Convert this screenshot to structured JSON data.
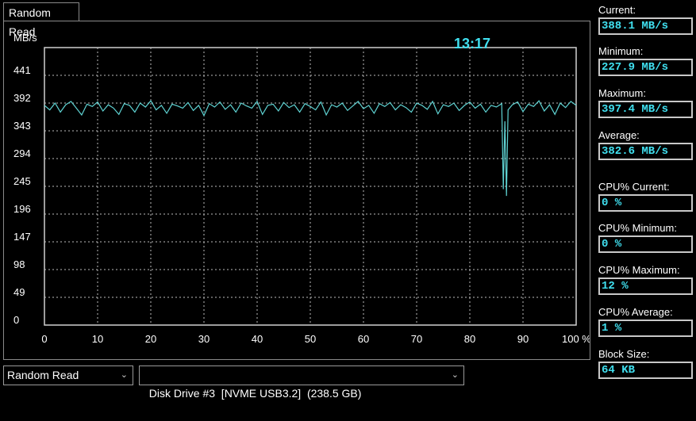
{
  "tab": {
    "label": "Random Read"
  },
  "chart_data": {
    "type": "line",
    "ylabel": "MB/s",
    "y_ticks": [
      "441",
      "392",
      "343",
      "294",
      "245",
      "196",
      "147",
      "98",
      "49",
      "0"
    ],
    "x_ticks": [
      "0",
      "10",
      "20",
      "30",
      "40",
      "50",
      "60",
      "70",
      "80",
      "90",
      "100 %"
    ],
    "ylim": [
      0,
      490
    ],
    "xlim": [
      0,
      100
    ],
    "grid": true,
    "timer": "13:17",
    "line_color": "#5fd3d3",
    "series": [
      {
        "x": [
          0,
          1,
          2,
          3,
          4,
          5,
          6,
          7,
          8,
          9,
          10,
          11,
          12,
          13,
          14,
          15,
          16,
          17,
          18,
          19,
          20,
          21,
          22,
          23,
          24,
          25,
          26,
          27,
          28,
          29,
          30,
          31,
          32,
          33,
          34,
          35,
          36,
          37,
          38,
          39,
          40,
          41,
          42,
          43,
          44,
          45,
          46,
          47,
          48,
          49,
          50,
          51,
          52,
          53,
          54,
          55,
          56,
          57,
          58,
          59,
          60,
          61,
          62,
          63,
          64,
          65,
          66,
          67,
          68,
          69,
          70,
          71,
          72,
          73,
          74,
          75,
          76,
          77,
          78,
          79,
          80,
          81,
          82,
          83,
          84,
          85,
          86,
          86.3,
          86.6,
          86.9,
          87.2,
          88,
          89,
          90,
          91,
          92,
          93,
          94,
          95,
          96,
          97,
          98,
          99,
          100
        ],
        "values": [
          388,
          380,
          392,
          376,
          389,
          395,
          383,
          371,
          390,
          386,
          394,
          378,
          389,
          383,
          372,
          391,
          388,
          376,
          392,
          385,
          396,
          380,
          388,
          374,
          390,
          387,
          383,
          393,
          379,
          388,
          370,
          391,
          385,
          394,
          381,
          389,
          376,
          392,
          387,
          383,
          395,
          372,
          388,
          390,
          378,
          393,
          384,
          389,
          376,
          391,
          386,
          380,
          394,
          371,
          389,
          385,
          392,
          379,
          387,
          395,
          382,
          388,
          374,
          391,
          386,
          393,
          380,
          389,
          384,
          376,
          392,
          388,
          381,
          395,
          373,
          389,
          386,
          392,
          379,
          388,
          394,
          383,
          390,
          376,
          388,
          385,
          391,
          240,
          360,
          228,
          380,
          389,
          394,
          377,
          390,
          386,
          396,
          378,
          389,
          372,
          392,
          384,
          395,
          388
        ]
      }
    ]
  },
  "stats": [
    {
      "label": "Current:",
      "value": "388.1 MB/s"
    },
    {
      "label": "Minimum:",
      "value": "227.9 MB/s"
    },
    {
      "label": "Maximum:",
      "value": "397.4 MB/s"
    },
    {
      "label": "Average:",
      "value": "382.6 MB/s"
    },
    {
      "label": "CPU% Current:",
      "value": "0 %"
    },
    {
      "label": "CPU% Minimum:",
      "value": "0 %"
    },
    {
      "label": "CPU% Maximum:",
      "value": "12 %"
    },
    {
      "label": "CPU% Average:",
      "value": "1 %"
    },
    {
      "label": "Block Size:",
      "value": "64 KB"
    }
  ],
  "test_select": {
    "value": "Random Read"
  },
  "drive_select": {
    "value": "Disk Drive #3  [NVME USB3.2]  (238.5 GB)"
  }
}
